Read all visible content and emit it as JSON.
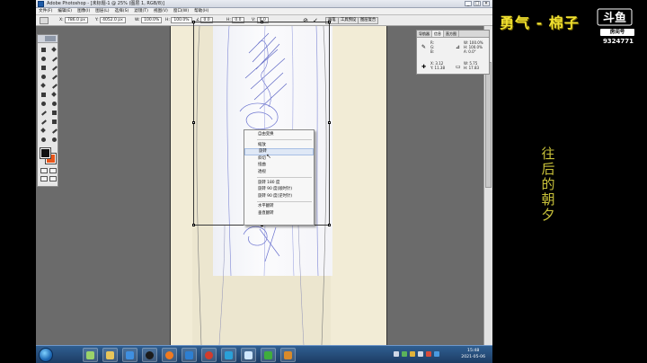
{
  "window": {
    "title": "Adobe Photoshop - [未标题-1 @ 25% (图层 1, RGB/8)]",
    "controls": [
      "_",
      "□",
      "×"
    ]
  },
  "menubar": [
    "文件(F)",
    "编辑(E)",
    "图像(I)",
    "图层(L)",
    "选择(S)",
    "滤镜(T)",
    "视图(V)",
    "窗口(W)",
    "帮助(H)"
  ],
  "options_bar": {
    "x_label": "X:",
    "x_value": "786.0 px",
    "y_label": "Y:",
    "y_value": "4052.0 px",
    "w_label": "W:",
    "w_value": "100.0%",
    "h_label": "H:",
    "h_value": "100.0%",
    "angle_label": "∠",
    "angle_value": "0.0",
    "hskew_label": "H:",
    "hskew_value": "0.0",
    "vskew_label": "V:",
    "vskew_value": "0.0",
    "cancel_glyph": "⊘",
    "commit_glyph": "✓",
    "palette_tabs": [
      "画笔",
      "工具预设",
      "图层复合"
    ]
  },
  "navigator": {
    "tabs": [
      "导航器",
      "信息",
      "直方图"
    ],
    "r_label": "R:",
    "g_label": "G:",
    "b_label": "B:",
    "w_label": "W:",
    "w_value": "100.0%",
    "h_label": "H:",
    "h_value": "100.0%",
    "a_label": "A:",
    "a_value": "0.0°",
    "x_label": "X:",
    "x_value": "3.12",
    "y_label": "Y:",
    "y_value": "11.38",
    "w2_label": "W:",
    "w2_value": "5.75",
    "h2_label": "H:",
    "h2_value": "17.83"
  },
  "context_menu": {
    "items": [
      {
        "label": "自由变换",
        "highlighted": false
      },
      {
        "separator": true
      },
      {
        "label": "缩放",
        "highlighted": false
      },
      {
        "label": "旋转",
        "highlighted": true
      },
      {
        "label": "斜切",
        "highlighted": false
      },
      {
        "label": "扭曲",
        "highlighted": false
      },
      {
        "label": "透视",
        "highlighted": false
      },
      {
        "separator": true
      },
      {
        "label": "旋转 180 度",
        "highlighted": false
      },
      {
        "label": "旋转 90 度(顺时针)",
        "highlighted": false
      },
      {
        "label": "旋转 90 度(逆时针)",
        "highlighted": false
      },
      {
        "separator": true
      },
      {
        "label": "水平翻转",
        "highlighted": false
      },
      {
        "label": "垂直翻转",
        "highlighted": false
      }
    ]
  },
  "taskbar": {
    "apps": [
      {
        "icon": "notepad-icon",
        "color": "#9bd36a"
      },
      {
        "icon": "folder-icon",
        "color": "#e8c65a"
      },
      {
        "icon": "media-player-icon",
        "color": "#3f8fe0"
      },
      {
        "icon": "qq-icon",
        "color": "#1b1b1b"
      },
      {
        "icon": "browser-icon",
        "color": "#f07a20"
      },
      {
        "icon": "photoshop-icon",
        "color": "#2d7fd2"
      },
      {
        "icon": "game-icon",
        "color": "#d23c2c"
      },
      {
        "icon": "ime-icon",
        "color": "#2aa0d8"
      },
      {
        "icon": "snowflake-icon",
        "color": "#cfe7ff"
      },
      {
        "icon": "security-icon",
        "color": "#3fae3c"
      },
      {
        "icon": "help-icon",
        "color": "#d88a2a"
      }
    ],
    "time": "15:48",
    "date": "2021-05-06"
  },
  "overlay": {
    "streamer_name": "勇气 - 棉子",
    "platform_logo": "斗鱼",
    "room_label": "房间号",
    "room_number": "9324771",
    "song_title": "往后的朝夕"
  },
  "colors": {
    "accent_yellow": "#f0e030",
    "song_color": "#c9c23a",
    "foreground_swatch": "#111111",
    "background_swatch": "#e8561a"
  }
}
